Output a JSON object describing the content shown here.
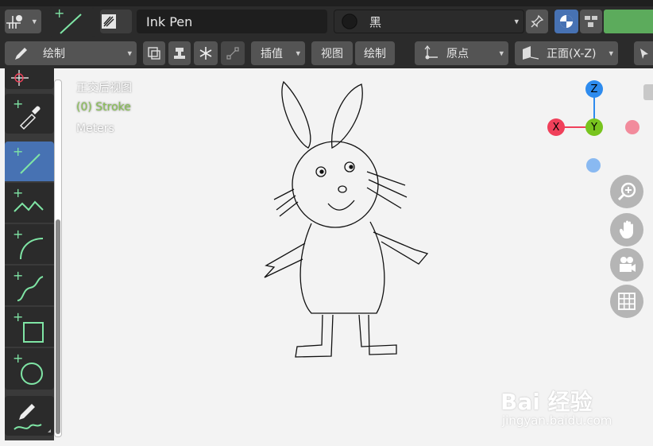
{
  "header": {
    "brush_name": "Ink Pen",
    "material_name": "黑"
  },
  "toolbar": {
    "mode_label": "绘制",
    "interpolate_label": "插值",
    "view_label": "视图",
    "draw_label": "绘制",
    "origin_label": "原点",
    "orientation_label": "正面(X-Z)"
  },
  "viewport": {
    "view_name": "正交后视图",
    "object_label": "(0) Stroke",
    "units_label": "Meters"
  },
  "gizmo": {
    "z_label": "Z",
    "x_label": "X",
    "y_label": "Y"
  },
  "watermark": {
    "brand": "Bai 经验",
    "url": "jingyan.baidu.com"
  },
  "colors": {
    "accent_active": "#4772b3",
    "green_text": "#8ac256",
    "axis_x": "#f0405a",
    "axis_y": "#78c41e",
    "axis_z": "#2d8bee",
    "material_swatch": "#5cab5c"
  },
  "tools": [
    {
      "name": "cursor-tool"
    },
    {
      "name": "eyedropper-tool"
    },
    {
      "name": "line-tool"
    },
    {
      "name": "polyline-tool"
    },
    {
      "name": "arc-tool"
    },
    {
      "name": "curve-tool"
    },
    {
      "name": "box-tool"
    },
    {
      "name": "circle-tool"
    },
    {
      "name": "annotate-tool"
    }
  ]
}
